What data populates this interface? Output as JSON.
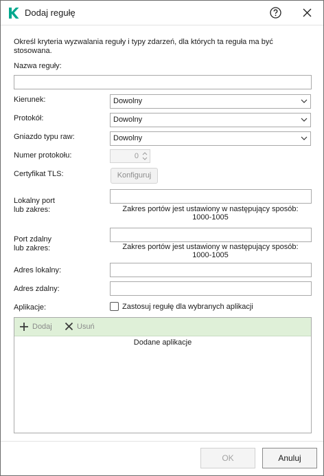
{
  "window": {
    "title": "Dodaj regułę",
    "description": "Określ kryteria wyzwalania reguły i typy zdarzeń, dla których ta reguła ma być stosowana."
  },
  "form": {
    "rule_name_label": "Nazwa reguły:",
    "rule_name_value": "",
    "direction_label": "Kierunek:",
    "direction_value": "Dowolny",
    "protocol_label": "Protokół:",
    "protocol_value": "Dowolny",
    "raw_socket_label": "Gniazdo typu raw:",
    "raw_socket_value": "Dowolny",
    "protocol_number_label": "Numer protokołu:",
    "protocol_number_value": "0",
    "tls_label": "Certyfikat TLS:",
    "tls_button": "Konfiguruj",
    "local_port_label_line1": "Lokalny port",
    "local_port_label_line2": "lub zakres:",
    "local_port_hint_line1": "Zakres portów jest ustawiony w następujący sposób:",
    "local_port_hint_line2": "1000-1005",
    "remote_port_label_line1": "Port zdalny",
    "remote_port_label_line2": "lub zakres:",
    "remote_port_hint_line1": "Zakres portów jest ustawiony w następujący sposób:",
    "remote_port_hint_line2": "1000-1005",
    "local_address_label": "Adres lokalny:",
    "remote_address_label": "Adres zdalny:",
    "apps_label": "Aplikacje:",
    "apps_checkbox_label": "Zastosuj regułę dla wybranych aplikacji",
    "apps_checkbox_checked": false
  },
  "apps_panel": {
    "add_label": "Dodaj",
    "remove_label": "Usuń",
    "column_header": "Dodane aplikacje",
    "toolbar_color": "#dff0d8"
  },
  "footer": {
    "ok_label": "OK",
    "cancel_label": "Anuluj"
  },
  "colors": {
    "brand": "#00a88e"
  },
  "icons": [
    "kaspersky-logo",
    "help-icon",
    "close-icon",
    "chevron-down-icon",
    "plus-icon",
    "x-icon",
    "spinner-arrows-icon"
  ]
}
